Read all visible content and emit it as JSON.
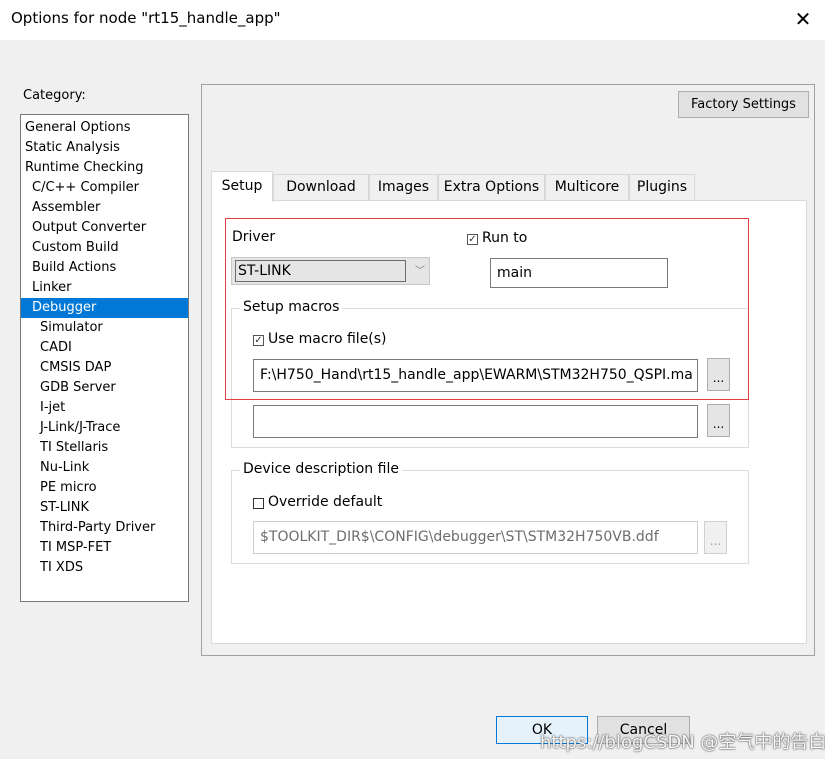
{
  "window": {
    "title": "Options for node \"rt15_handle_app\"",
    "close_glyph": "✕"
  },
  "category": {
    "label": "Category:",
    "selected": "Debugger",
    "items": [
      {
        "label": "General Options"
      },
      {
        "label": "Static Analysis"
      },
      {
        "label": "Runtime Checking"
      },
      {
        "label": "C/C++ Compiler"
      },
      {
        "label": "Assembler"
      },
      {
        "label": "Output Converter"
      },
      {
        "label": "Custom Build"
      },
      {
        "label": "Build Actions"
      },
      {
        "label": "Linker"
      },
      {
        "label": "Debugger"
      },
      {
        "label": "Simulator"
      },
      {
        "label": "CADI"
      },
      {
        "label": "CMSIS DAP"
      },
      {
        "label": "GDB Server"
      },
      {
        "label": "I-jet"
      },
      {
        "label": "J-Link/J-Trace"
      },
      {
        "label": "TI Stellaris"
      },
      {
        "label": "Nu-Link"
      },
      {
        "label": "PE micro"
      },
      {
        "label": "ST-LINK"
      },
      {
        "label": "Third-Party Driver"
      },
      {
        "label": "TI MSP-FET"
      },
      {
        "label": "TI XDS"
      }
    ]
  },
  "factory_settings_label": "Factory Settings",
  "tabs": [
    {
      "label": "Setup"
    },
    {
      "label": "Download"
    },
    {
      "label": "Images"
    },
    {
      "label": "Extra Options"
    },
    {
      "label": "Multicore"
    },
    {
      "label": "Plugins"
    }
  ],
  "active_tab": "Setup",
  "setup": {
    "driver_label": "Driver",
    "driver_value": "ST-LINK",
    "run_to_label": "Run to",
    "run_to_checked": true,
    "run_to_value": "main",
    "setup_macros_label": "Setup macros",
    "use_macro_label": "Use macro file(s)",
    "use_macro_checked": true,
    "macro_file_1": "F:\\H750_Hand\\rt15_handle_app\\EWARM\\STM32H750_QSPI.ma",
    "macro_file_2": "",
    "browse_label": "...",
    "device_desc_label": "Device description file",
    "override_label": "Override default",
    "override_checked": false,
    "device_desc_value": "$TOOLKIT_DIR$\\CONFIG\\debugger\\ST\\STM32H750VB.ddf"
  },
  "buttons": {
    "ok": "OK",
    "cancel": "Cancel"
  },
  "watermark": "https://blogCSDN @空气中的告白"
}
